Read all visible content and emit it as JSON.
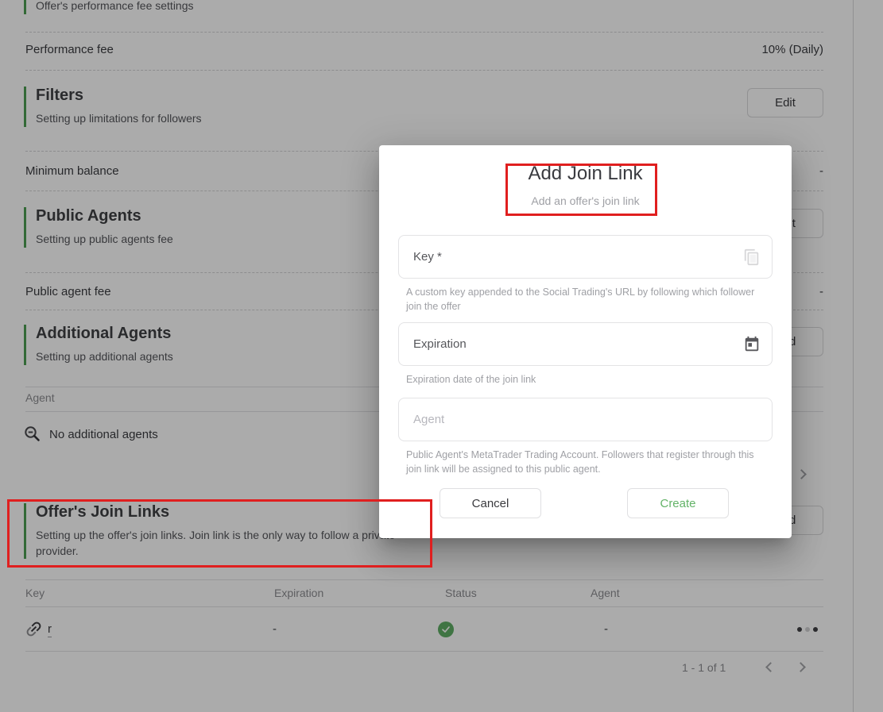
{
  "page": {
    "perf_section": {
      "subtitle": "Offer's performance fee settings"
    },
    "performance_fee": {
      "label": "Performance fee",
      "value": "10% (Daily)"
    },
    "filters": {
      "title": "Filters",
      "subtitle": "Setting up limitations for followers",
      "button": "Edit"
    },
    "minimum_balance": {
      "label": "Minimum balance",
      "value": "-"
    },
    "public_agents": {
      "title": "Public Agents",
      "subtitle": "Setting up public agents fee",
      "button": "Edit"
    },
    "public_agent_fee": {
      "label": "Public agent fee",
      "value": "-"
    },
    "additional_agents": {
      "title": "Additional Agents",
      "subtitle": "Setting up additional agents",
      "button": "Add",
      "table": {
        "header": "Agent",
        "empty": "No additional agents"
      }
    },
    "join_links": {
      "title": "Offer's Join Links",
      "subtitle": "Setting up the offer's join links. Join link is the only way to follow a private provider.",
      "button": "Add",
      "table": {
        "headers": [
          "Key",
          "Expiration",
          "Status",
          "Agent"
        ],
        "row": {
          "key": "r",
          "expiration": "-",
          "agent": "-"
        }
      },
      "pagination": {
        "range": "1 - 1 of 1"
      }
    }
  },
  "modal": {
    "title": "Add Join Link",
    "subtitle": "Add an offer's join link",
    "key_field": {
      "placeholder": "Key *",
      "helper": "A custom key appended to the Social Trading's URL by following which follower join the offer"
    },
    "expiration_field": {
      "placeholder": "Expiration",
      "helper": "Expiration date of the join link"
    },
    "agent_field": {
      "placeholder": "Agent",
      "helper": "Public Agent's MetaTrader Trading Account. Followers that register through this join link will be assigned to this public agent."
    },
    "cancel_label": "Cancel",
    "create_label": "Create"
  },
  "colors": {
    "accent_green": "#4c9e52",
    "success_green": "#5fae64",
    "create_green": "#63b368",
    "annotation_red": "#e01f1f"
  },
  "icons": {
    "key_row": "chain-link-icon",
    "empty_state": "zoom-out-icon",
    "key_field": "copy-icon",
    "expiration_field": "calendar-icon",
    "status": "check-circle-icon",
    "row_menu": "dots-menu-icon",
    "pagination_prev": "chevron-left-icon",
    "pagination_next": "chevron-right-icon"
  }
}
